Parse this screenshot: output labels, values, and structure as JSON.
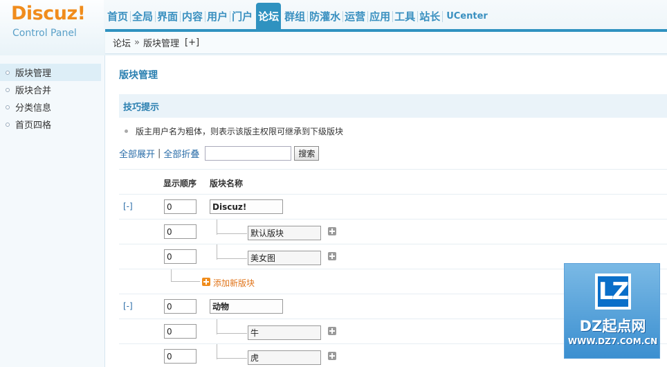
{
  "logo": {
    "brand": "Discuz!",
    "subtitle": "Control Panel"
  },
  "topnav": {
    "items": [
      {
        "label": "首页"
      },
      {
        "label": "全局"
      },
      {
        "label": "界面"
      },
      {
        "label": "内容"
      },
      {
        "label": "用户"
      },
      {
        "label": "门户"
      },
      {
        "label": "论坛",
        "active": true
      },
      {
        "label": "群组"
      },
      {
        "label": "防灌水"
      },
      {
        "label": "运营"
      },
      {
        "label": "应用"
      },
      {
        "label": "工具"
      },
      {
        "label": "站长"
      },
      {
        "label": "UCenter"
      }
    ]
  },
  "breadcrumb": {
    "section": "论坛",
    "separator": "»",
    "page": "版块管理",
    "add": "[+]"
  },
  "sidebar": {
    "items": [
      {
        "label": "版块管理",
        "active": true
      },
      {
        "label": "版块合并"
      },
      {
        "label": "分类信息"
      },
      {
        "label": "首页四格"
      }
    ]
  },
  "main": {
    "title": "版块管理",
    "tips": {
      "title": "技巧提示",
      "line": "版主用户名为粗体，则表示该版主权限可继承到下级版块"
    },
    "toolbar": {
      "expand_all": "全部展开",
      "pipe": "|",
      "collapse_all": "全部折叠",
      "search_placeholder": "",
      "search_button": "搜索"
    },
    "table": {
      "col_order": "显示顺序",
      "col_name": "版块名称",
      "groups": [
        {
          "toggle": "[-]",
          "order": "0",
          "name": "Discuz!",
          "forums": [
            {
              "order": "0",
              "name": "默认版块"
            },
            {
              "order": "0",
              "name": "美女图"
            }
          ],
          "add_label": "添加新版块"
        },
        {
          "toggle": "[-]",
          "order": "0",
          "name": "动物",
          "forums": [
            {
              "order": "0",
              "name": "牛"
            },
            {
              "order": "0",
              "name": "虎"
            }
          ]
        }
      ]
    }
  },
  "watermark": {
    "badge": "LZ",
    "title": "DZ起点网",
    "url": "WWW.DZ7.COM.CN"
  }
}
